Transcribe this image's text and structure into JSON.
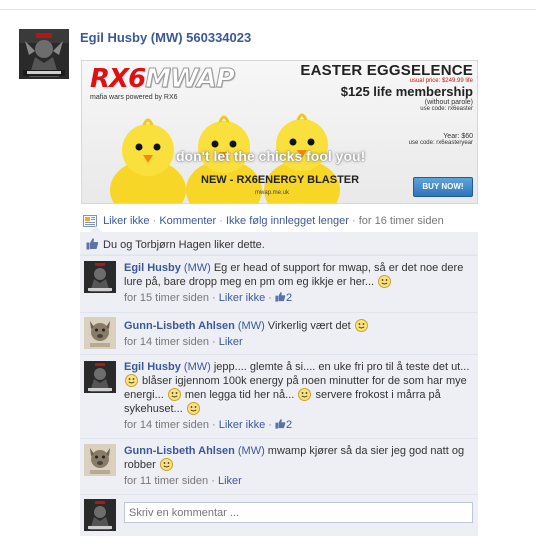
{
  "post": {
    "author": "Egil Husby (MW) 560334023",
    "actions": {
      "unlike": "Liker ikke",
      "comment": "Kommenter",
      "unfollow": "Ikke følg innlegget lenger",
      "time": "for 16 timer siden"
    }
  },
  "banner": {
    "logo_rx6": "RX6",
    "logo_mwap": "MWAP",
    "logo_sub": "mafia wars powered by RX6",
    "title": "EASTER EGGSELENCE",
    "usual_price": "usual price: $249.99 life",
    "membership": "$125 life membership",
    "parole": "(without parole)",
    "use_code_1": "use code: rx6easter",
    "year": "Year: $60",
    "use_code_2": "use code: rx6easteryear",
    "tagline": "don't let the chicks fool you!",
    "new_line": "NEW - RX6ENERGY BLASTER",
    "site": "mwap.me.uk",
    "buy": "BUY NOW!"
  },
  "likes": {
    "prefix": "Du og ",
    "name": "Torbjørn Hagen",
    "suffix": " liker dette."
  },
  "comments": [
    {
      "name": "Egil Husby",
      "tag": "(MW)",
      "text_1": " Eg er head of support for mwap, så er det noe dere lure på, bare dropp meg en pm om eg ikkje er her...",
      "time": "for 15 timer siden",
      "like_label": "Liker ikke",
      "like_count": "2"
    },
    {
      "name": "Gunn-Lisbeth Ahlsen",
      "tag": "(MW)",
      "text_1": " Virkerlig vært det",
      "time": "for 14 timer siden",
      "like_label": "Liker"
    },
    {
      "name": "Egil Husby",
      "tag": "(MW)",
      "text_1": " jepp.... glemte å si.... en uke fri pro til å teste det ut...",
      "text_2": " blåser igjennom 100k energy på noen minutter for de som har mye energi...",
      "text_3": " men legga tid her nå...",
      "text_4": " servere frokost i mårra på sykehuset...",
      "time": "for 14 timer siden",
      "like_label": "Liker ikke",
      "like_count": "2"
    },
    {
      "name": "Gunn-Lisbeth Ahlsen",
      "tag": "(MW)",
      "text_1": " mwamp kjører så da sier jeg god natt og robber",
      "time": "for 11 timer siden",
      "like_label": "Liker"
    }
  ],
  "reply": {
    "placeholder": "Skriv en kommentar ..."
  },
  "colors": {
    "link": "#3b5998",
    "comment_bg": "#edeff4",
    "logo_red": "#e01010",
    "buy_button": "#2f74bd"
  }
}
